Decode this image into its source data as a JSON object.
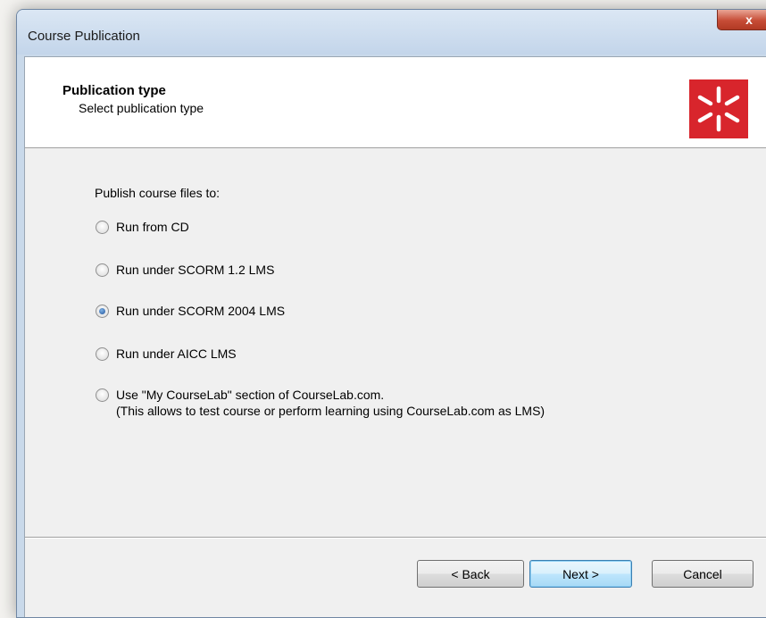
{
  "window": {
    "title": "Course Publication",
    "close_label": "x"
  },
  "header": {
    "title": "Publication type",
    "subtitle": "Select publication type",
    "logo_icon": "asterisk-burst-logo",
    "logo_color": "#d8252c"
  },
  "main": {
    "section_label": "Publish course files to:",
    "options": [
      {
        "label": "Run from CD",
        "checked": false
      },
      {
        "label": "Run under SCORM 1.2 LMS",
        "checked": false
      },
      {
        "label": "Run under SCORM 2004 LMS",
        "checked": true
      },
      {
        "label": "Run under AICC LMS",
        "checked": false
      },
      {
        "label": "Use \"My CourseLab\" section of CourseLab.com.",
        "label2": "(This allows to test course or perform learning using CourseLab.com as LMS)",
        "checked": false
      }
    ]
  },
  "buttons": {
    "back": "< Back",
    "next": "Next >",
    "cancel": "Cancel"
  }
}
